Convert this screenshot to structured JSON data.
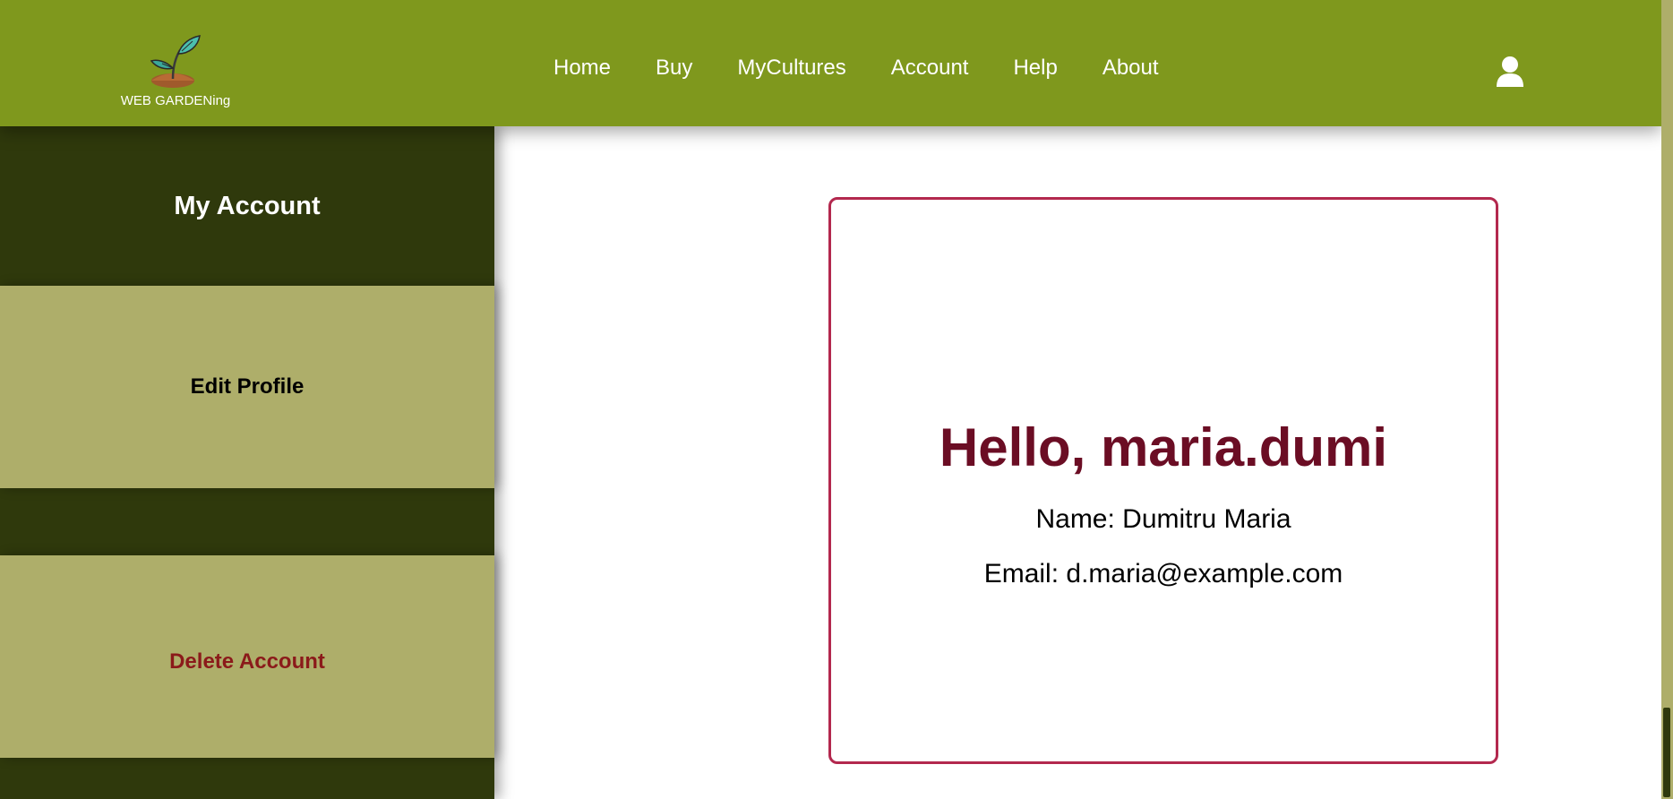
{
  "header": {
    "logo_text": "WEB GARDENing",
    "logo_icon": "plant-sprout-icon",
    "nav": [
      "Home",
      "Buy",
      "MyCultures",
      "Account",
      "Help",
      "About"
    ],
    "user_icon": "user-icon"
  },
  "sidebar": {
    "title": "My Account",
    "edit_label": "Edit Profile",
    "delete_label": "Delete Account"
  },
  "profile": {
    "greeting": "Hello, maria.dumi",
    "name_line": "Name: Dumitru Maria",
    "email_line": "Email: d.maria@example.com"
  },
  "colors": {
    "header_bg": "#7f981d",
    "sidebar_bg": "#2f390c",
    "sidebar_button_bg": "#aeae6a",
    "card_border": "#b3284e",
    "greeting_color": "#6b0d24",
    "delete_color": "#8b1a1a"
  }
}
